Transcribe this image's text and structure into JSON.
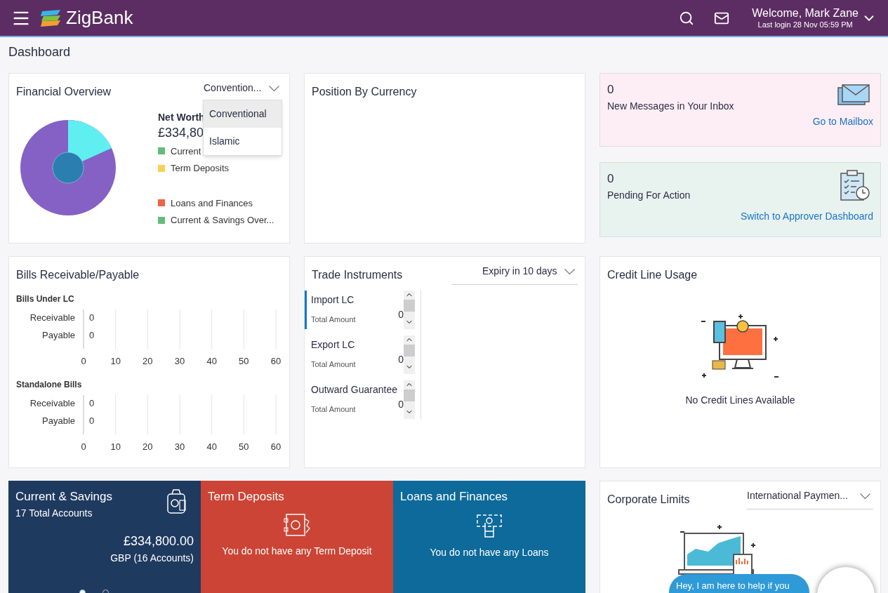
{
  "header": {
    "brand": "ZigBank",
    "welcome": "Welcome, Mark Zane",
    "last_login": "Last login 28 Nov 05:59 PM"
  },
  "page_title": "Dashboard",
  "financial_overview": {
    "title": "Financial Overview",
    "dropdown": {
      "value": "Convention...",
      "options": [
        {
          "label": "Conventional",
          "selected": true
        },
        {
          "label": "Islamic",
          "selected": false
        }
      ]
    },
    "net_worth_label": "Net Worth",
    "net_worth_value": "£334,80",
    "legend": [
      {
        "label": "Current",
        "color": "#66bb7a"
      },
      {
        "label": "Term Deposits",
        "color": "#f7d154"
      },
      {
        "label": "Loans and Finances",
        "color": "#ee6446"
      },
      {
        "label": "Current & Savings Over...",
        "color": "#66bb7a"
      }
    ]
  },
  "position_by_currency": {
    "title": "Position By Currency"
  },
  "messages": {
    "count": "0",
    "label": "New Messages in Your Inbox",
    "link": "Go to Mailbox"
  },
  "pending": {
    "count": "0",
    "label": "Pending For Action",
    "link": "Switch to Approver Dashboard"
  },
  "bills": {
    "title": "Bills Receivable/Payable",
    "sections": [
      {
        "heading": "Bills Under LC",
        "chart_data": {
          "type": "bar",
          "orientation": "horizontal",
          "categories": [
            "Receivable",
            "Payable"
          ],
          "values": [
            0,
            0
          ],
          "xlim": [
            0,
            60
          ],
          "xticks": [
            0,
            10,
            20,
            30,
            40,
            50,
            60
          ],
          "data_labels": true,
          "grid": true
        }
      },
      {
        "heading": "Standalone Bills",
        "chart_data": {
          "type": "bar",
          "orientation": "horizontal",
          "categories": [
            "Receivable",
            "Payable"
          ],
          "values": [
            0,
            0
          ],
          "xlim": [
            0,
            60
          ],
          "xticks": [
            0,
            10,
            20,
            30,
            40,
            50,
            60
          ],
          "data_labels": true,
          "grid": true
        }
      }
    ]
  },
  "trade_instruments": {
    "title": "Trade Instruments",
    "filter": "Expiry in 10 days",
    "items": [
      {
        "name": "Import LC",
        "sub": "Total Amount",
        "amount": "0",
        "selected": true
      },
      {
        "name": "Export LC",
        "sub": "Total Amount",
        "amount": "0",
        "selected": false
      },
      {
        "name": "Outward Guarantee",
        "sub": "Total Amount",
        "amount": "0",
        "selected": false
      }
    ]
  },
  "credit_line": {
    "title": "Credit Line Usage",
    "empty": "No Credit Lines Available"
  },
  "tiles": [
    {
      "kind": "casa",
      "title": "Current & Savings",
      "subtitle": "17 Total Accounts",
      "amount": "£334,800.00",
      "detail": "GBP (16 Accounts)",
      "color": "#1f3a5f",
      "dots": [
        {
          "selected": true
        },
        {
          "selected": false
        }
      ]
    },
    {
      "kind": "deposit",
      "title": "Term Deposits",
      "message": "You do not have any Term Deposit",
      "color": "#cc4435"
    },
    {
      "kind": "loan",
      "title": "Loans and Finances",
      "message": "You do not have any Loans",
      "color": "#0d6a9a"
    }
  ],
  "corporate_limits": {
    "title": "Corporate Limits",
    "filter": "International Paymen..."
  },
  "chat": {
    "message": "Hey, I am here to help if you"
  }
}
